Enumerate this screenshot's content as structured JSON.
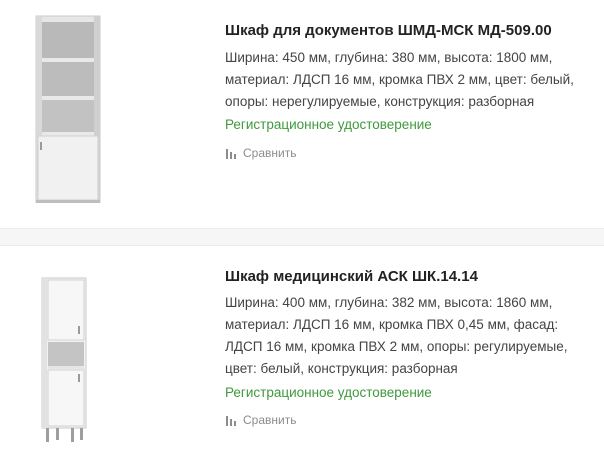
{
  "products": [
    {
      "title": "Шкаф для документов ШМД-МСК МД-509.00",
      "desc_lines": [
        "Ширина: 450 мм, глубина: 380 мм, высота: 1800 мм,",
        "материал: ЛДСП 16 мм, кромка ПВХ 2 мм, цвет: белый,",
        "опоры: нерегулируемые, конструкция: разборная"
      ],
      "registration_link": "Регистрационное удостоверение",
      "compare_label": "Сравнить",
      "image_icon": "cabinet-open-shelves-icon"
    },
    {
      "title": "Шкаф медицинский АСК ШК.14.14",
      "desc_lines": [
        "Ширина: 400 мм, глубина: 382 мм, высота: 1860 мм,",
        "материал: ЛДСП 16 мм, кромка ПВХ 0,45 мм, фасад:",
        "ЛДСП 16 мм, кромка ПВХ 2 мм, опоры: регулируемые,",
        "цвет: белый, конструкция: разборная"
      ],
      "registration_link": "Регистрационное удостоверение",
      "compare_label": "Сравнить",
      "image_icon": "medical-cabinet-icon"
    }
  ],
  "colors": {
    "link_green": "#3e9a3c",
    "compare_gray": "#8c8c8c",
    "title": "#222222"
  }
}
